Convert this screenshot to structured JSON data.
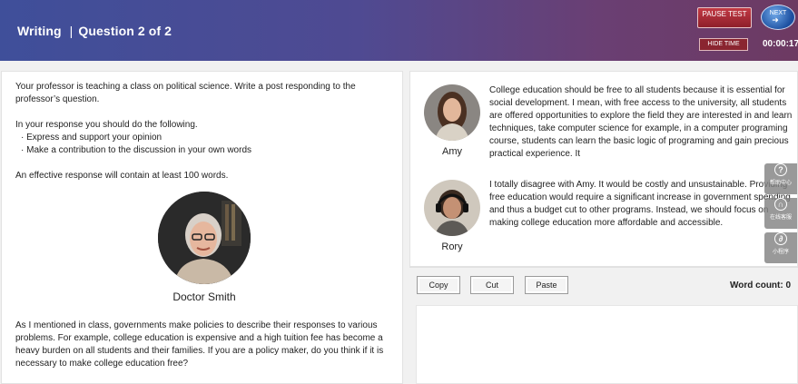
{
  "header": {
    "section": "Writing",
    "question": "Question 2 of 2",
    "pause_label": "PAUSE TEST",
    "next_label": "NEXT",
    "hide_time_label": "HIDE TIME",
    "timer": "00:00:17"
  },
  "prompt": {
    "intro": "Your professor is teaching a class on political science. Write a post responding to the professor’s question.",
    "instruction": "In your response you should do the following.",
    "bullets": [
      "· Express and support your opinion",
      "· Make a contribution to the discussion in your own words"
    ],
    "length_note": "An effective response will contain at least 100 words."
  },
  "professor": {
    "name": "Doctor Smith",
    "speech": "As I mentioned in class, governments make policies to describe their responses to various problems. For example, college education is expensive and a high tuition fee has become a heavy burden on all students and their families. If you are a policy maker, do you think if it is necessary to make college education free?"
  },
  "students": [
    {
      "name": "Amy",
      "post": "College education should be free to all students because it is essential for social development. I mean, with free access to the university, all students are offered opportunities to explore the field they are interested in and learn techniques, take computer science for example, in a computer programing course, students can learn the basic logic of programing and gain precious practical experience. It"
    },
    {
      "name": "Rory",
      "post": "I totally disagree with Amy. It would be costly and unsustainable. Providing free education would require a significant increase in government spending and thus a budget cut to other programs. Instead, we should focus on making college education more affordable and accessible."
    }
  ],
  "editor_toolbar": {
    "copy": "Copy",
    "cut": "Cut",
    "paste": "Paste",
    "word_count_label": "Word count:",
    "word_count": "0"
  },
  "sidebar": [
    {
      "icon": "help-icon",
      "label": "帮助中心"
    },
    {
      "icon": "headset-icon",
      "label": "在线客服"
    },
    {
      "icon": "miniprogram-icon",
      "label": "小程序"
    }
  ]
}
